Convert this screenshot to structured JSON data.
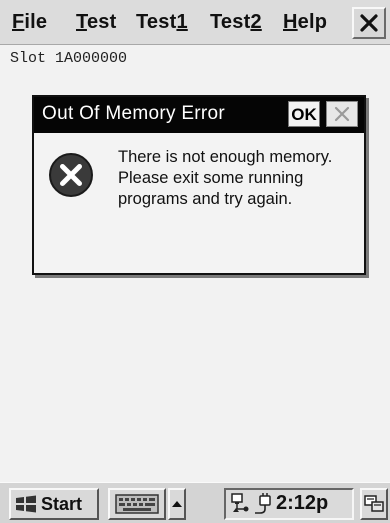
{
  "menubar": {
    "items": [
      {
        "label": "File",
        "mnemonic": "F",
        "rest": "ile"
      },
      {
        "label": "Test",
        "mnemonic": "T",
        "rest": "est"
      },
      {
        "label": "Test1",
        "prefix": "Test",
        "mnemonic": "1"
      },
      {
        "label": "Test2",
        "prefix": "Test",
        "mnemonic": "2"
      },
      {
        "label": "Help",
        "mnemonic": "H",
        "rest": "elp"
      }
    ],
    "close_icon": "close-icon"
  },
  "content": {
    "slot_text": "Slot 1A000000"
  },
  "dialog": {
    "title": "Out Of Memory Error",
    "ok_label": "OK",
    "message": "There is not enough memory. Please exit some running programs and try again.",
    "icon": "error-x-icon"
  },
  "taskbar": {
    "start_label": "Start",
    "clock": "2:12p",
    "icons": [
      "windows-flag-icon",
      "keyboard-icon",
      "up-arrow-icon",
      "network-icon",
      "power-plug-icon",
      "desktop-icon"
    ]
  },
  "colors": {
    "titlebar": "#050505",
    "error_icon": "#333333"
  }
}
